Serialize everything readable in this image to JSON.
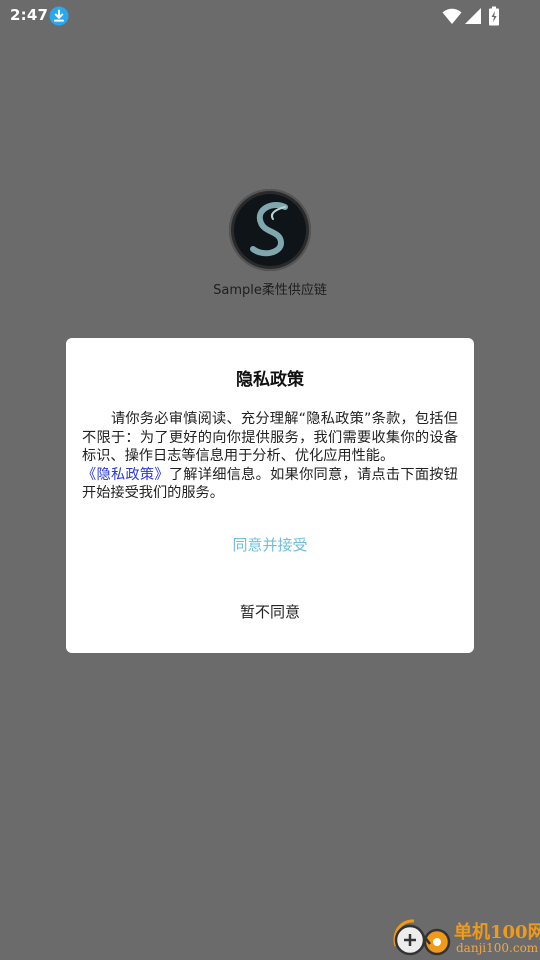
{
  "status_bar": {
    "time": "2:47",
    "icons": [
      "download-icon",
      "wifi-icon",
      "signal-icon",
      "battery-charging-icon"
    ],
    "download_color": "#29a8f0"
  },
  "splash": {
    "app_name": "Sample柔性供应链",
    "logo_icon": "s-logo-icon"
  },
  "dialog": {
    "title": "隐私政策",
    "body_text": "请你务必审慎阅读、充分理解“隐私政策”条款，包括但不限于：为了更好的向你提供服务，我们需要收集你的设备标识、操作日志等信息用于分析、优化应用性能。",
    "policy_link": "《隐私政策》",
    "body_text_2": "了解详细信息。如果你同意，请点击下面按钮开始接受我们的服务。",
    "agree_label": "同意并接受",
    "disagree_label": "暂不同意",
    "agree_color": "#6fbfd8",
    "link_color": "#2a3ad6"
  },
  "watermark": {
    "name": "单机100网",
    "url": "danji100.com",
    "color": "#f19a1a"
  }
}
